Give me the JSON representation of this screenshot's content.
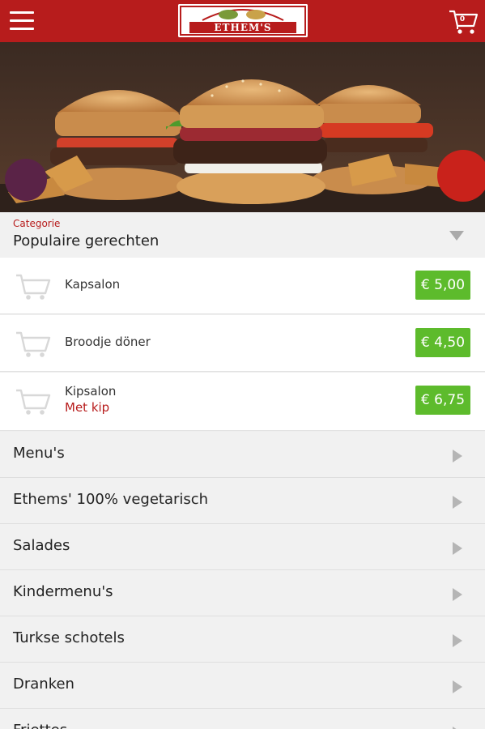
{
  "header": {
    "logo_text": "ETHEM'S",
    "cart_count": "0",
    "background": "#b71c1c"
  },
  "category_selector": {
    "label": "Categorie",
    "value": "Populaire gerechten"
  },
  "products": [
    {
      "name": "Kapsalon",
      "subtitle": "",
      "price": "€ 5,00"
    },
    {
      "name": "Broodje döner",
      "subtitle": "",
      "price": "€ 4,50"
    },
    {
      "name": "Kipsalon",
      "subtitle": "Met kip",
      "price": "€ 6,75"
    }
  ],
  "categories": [
    {
      "label": "Menu's"
    },
    {
      "label": "Ethems' 100% vegetarisch"
    },
    {
      "label": "Salades"
    },
    {
      "label": "Kindermenu's"
    },
    {
      "label": "Turkse schotels"
    },
    {
      "label": "Dranken"
    },
    {
      "label": "Friettes"
    }
  ],
  "colors": {
    "accent": "#b71c1c",
    "price_green": "#5dbb2c",
    "icons": {
      "menu": "hamburger-icon",
      "cart": "shopping-cart-icon",
      "dropdown": "triangle-down-icon",
      "chevron": "triangle-right-icon"
    }
  }
}
